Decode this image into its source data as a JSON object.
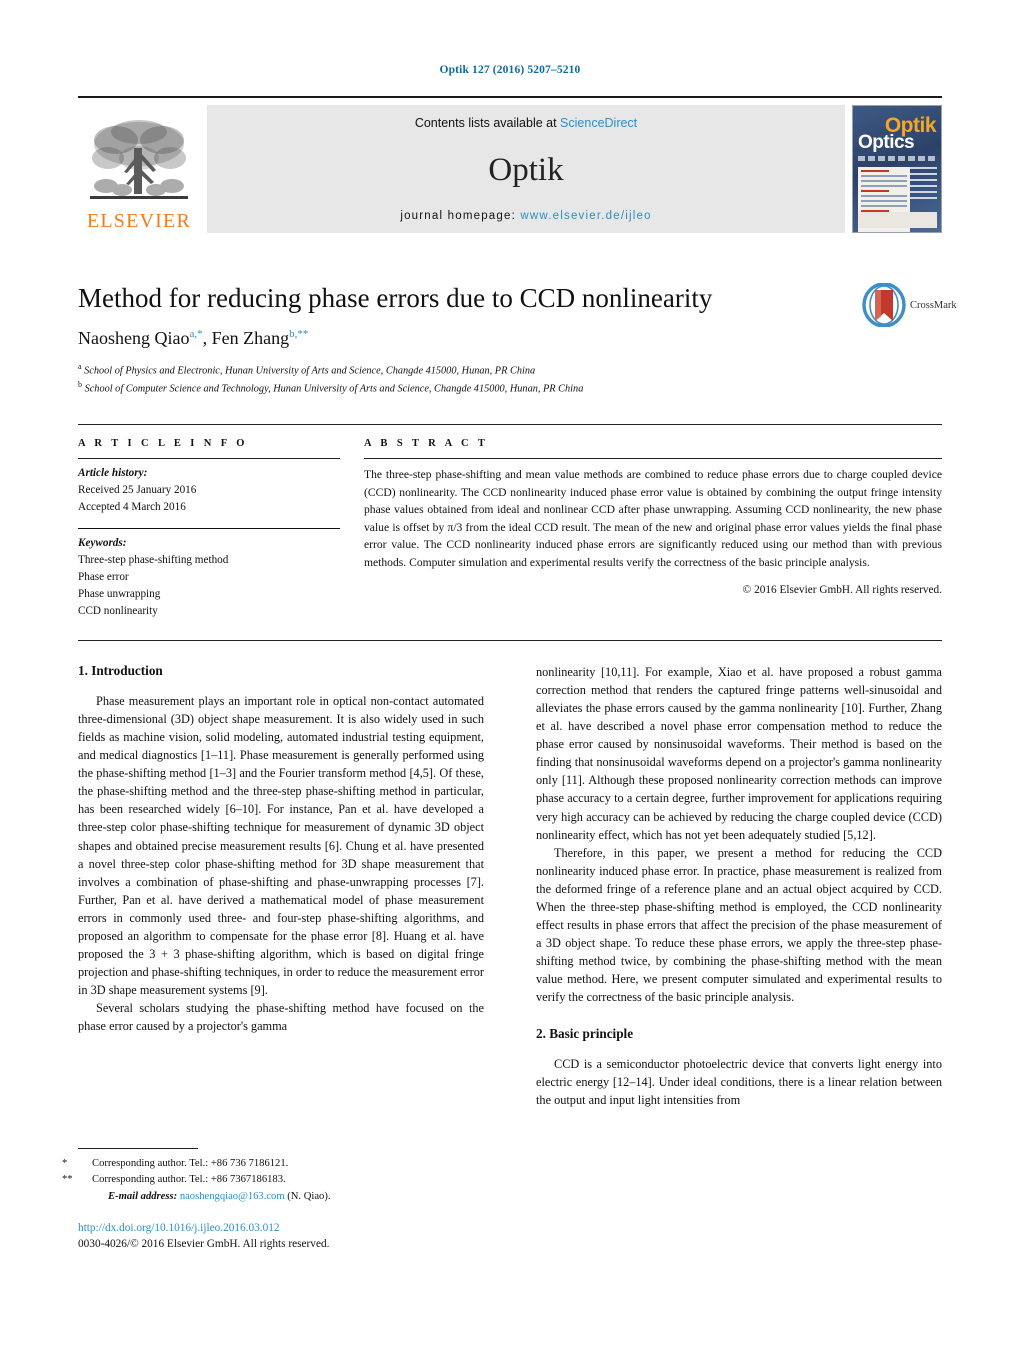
{
  "running_head": "Optik 127 (2016) 5207–5210",
  "masthead": {
    "contents_prefix": "Contents lists available at ",
    "sciencedirect": "ScienceDirect",
    "journal_name": "Optik",
    "homepage_prefix": "journal homepage: ",
    "homepage_url": "www.elsevier.de/ijleo",
    "publisher_logo_text": "ELSEVIER",
    "cover_title_top": "Optik",
    "cover_title_bottom": "Optics",
    "link_color": "#2b8fc9",
    "accent_orange": "#f07c1e"
  },
  "title_block": {
    "title": "Method for reducing phase errors due to CCD nonlinearity",
    "author_1": "Naosheng Qiao",
    "author_1_sup": "a,*",
    "author_sep": ", ",
    "author_2": "Fen Zhang",
    "author_2_sup": "b,**",
    "affiliation_a_sup": "a",
    "affiliation_a": " School of Physics and Electronic, Hunan University of Arts and Science, Changde 415000, Hunan, PR China",
    "affiliation_b_sup": "b",
    "affiliation_b": " School of Computer Science and Technology, Hunan University of Arts and Science, Changde 415000, Hunan, PR China",
    "crossmark_label": "CrossMark"
  },
  "article_info": {
    "heading": "A R T I C L E   I N F O",
    "history_label": "Article history:",
    "received": "Received 25 January 2016",
    "accepted": "Accepted 4 March 2016",
    "keywords_label": "Keywords:",
    "keywords": [
      "Three-step phase-shifting method",
      "Phase error",
      "Phase unwrapping",
      "CCD nonlinearity"
    ]
  },
  "abstract": {
    "heading": "A B S T R A C T",
    "text": "The three-step phase-shifting and mean value methods are combined to reduce phase errors due to charge coupled device (CCD) nonlinearity. The CCD nonlinearity induced phase error value is obtained by combining the output fringe intensity phase values obtained from ideal and nonlinear CCD after phase unwrapping. Assuming CCD nonlinearity, the new phase value is offset by π/3 from the ideal CCD result. The mean of the new and original phase error values yields the final phase error value. The CCD nonlinearity induced phase errors are significantly reduced using our method than with previous methods. Computer simulation and experimental results verify the correctness of the basic principle analysis.",
    "copyright": "© 2016 Elsevier GmbH. All rights reserved."
  },
  "body": {
    "section_1_heading": "1.  Introduction",
    "section_2_heading": "2.  Basic principle",
    "left_paragraphs": [
      "Phase measurement plays an important role in optical non-contact automated three-dimensional (3D) object shape measurement. It is also widely used in such fields as machine vision, solid modeling, automated industrial testing equipment, and medical diagnostics [1–11]. Phase measurement is generally performed using the phase-shifting method [1–3] and the Fourier transform method [4,5]. Of these, the phase-shifting method and the three-step phase-shifting method in particular, has been researched widely [6–10]. For instance, Pan et al. have developed a three-step color phase-shifting technique for measurement of dynamic 3D object shapes and obtained precise measurement results [6]. Chung et al. have presented a novel three-step color phase-shifting method for 3D shape measurement that involves a combination of phase-shifting and phase-unwrapping processes [7]. Further, Pan et al. have derived a mathematical model of phase measurement errors in commonly used three- and four-step phase-shifting algorithms, and proposed an algorithm to compensate for the phase error [8]. Huang et al. have proposed the 3 + 3 phase-shifting algorithm, which is based on digital fringe projection and phase-shifting techniques, in order to reduce the measurement error in 3D shape measurement systems [9].",
      "Several scholars studying the phase-shifting method have focused on the phase error caused by a projector's gamma"
    ],
    "right_paragraphs": [
      "nonlinearity [10,11]. For example, Xiao et al. have proposed a robust gamma correction method that renders the captured fringe patterns well-sinusoidal and alleviates the phase errors caused by the gamma nonlinearity [10]. Further, Zhang et al. have described a novel phase error compensation method to reduce the phase error caused by nonsinusoidal waveforms. Their method is based on the finding that nonsinusoidal waveforms depend on a projector's gamma nonlinearity only [11]. Although these proposed nonlinearity correction methods can improve phase accuracy to a certain degree, further improvement for applications requiring very high accuracy can be achieved by reducing the charge coupled device (CCD) nonlinearity effect, which has not yet been adequately studied [5,12].",
      "Therefore, in this paper, we present a method for reducing the CCD nonlinearity induced phase error. In practice, phase measurement is realized from the deformed fringe of a reference plane and an actual object acquired by CCD. When the three-step phase-shifting method is employed, the CCD nonlinearity effect results in phase errors that affect the precision of the phase measurement of a 3D object shape. To reduce these phase errors, we apply the three-step phase-shifting method twice, by combining the phase-shifting method with the mean value method. Here, we present computer simulated and experimental results to verify the correctness of the basic principle analysis."
    ],
    "section_2_paragraph": "CCD is a semiconductor photoelectric device that converts light energy into electric energy [12–14]. Under ideal conditions, there is a linear relation between the output and input light intensities from"
  },
  "footnotes": {
    "fn1_mark": "*",
    "fn1_text": "Corresponding author. Tel.: +86 736 7186121.",
    "fn2_mark": "**",
    "fn2_text": "Corresponding author. Tel.: +86 7367186183.",
    "email_label": "E-mail address:",
    "email": "naoshengqiao@163.com",
    "email_suffix": " (N. Qiao).",
    "doi": "http://dx.doi.org/10.1016/j.ijleo.2016.03.012",
    "issn_copyright": "0030-4026/© 2016 Elsevier GmbH. All rights reserved."
  }
}
